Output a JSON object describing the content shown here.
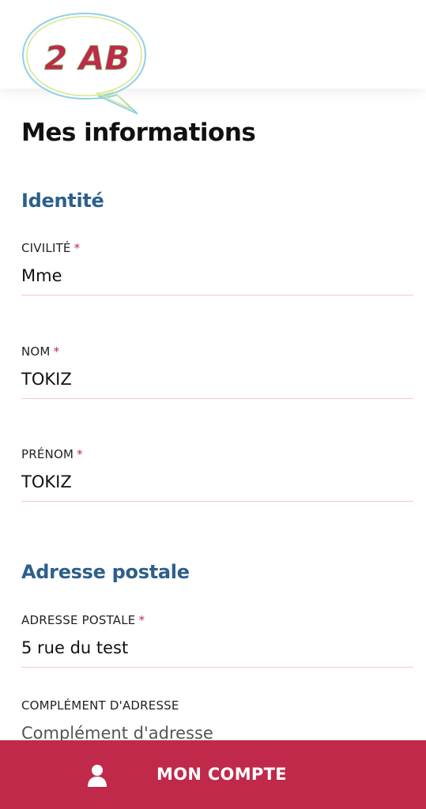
{
  "logo": {
    "text": "2 AB"
  },
  "header": {
    "menu_icon": "hamburger-menu-icon"
  },
  "page": {
    "title": "Mes informations"
  },
  "sections": {
    "identity": {
      "title": "Identité",
      "civility": {
        "label": "CIVILITÉ",
        "required": "*",
        "value": "Mme"
      },
      "last_name": {
        "label": "NOM",
        "required": "*",
        "value": "TOKIZ"
      },
      "first_name": {
        "label": "PRÉNOM",
        "required": "*",
        "value": "TOKIZ"
      }
    },
    "address": {
      "title": "Adresse postale",
      "street": {
        "label": "ADRESSE POSTALE",
        "required": "*",
        "value": "5 rue du test"
      },
      "complement": {
        "label": "COMPLÉMENT D'ADRESSE",
        "placeholder": "Complément d'adresse"
      }
    }
  },
  "bottom_bar": {
    "label": "MON COMPTE",
    "icon": "user-icon"
  },
  "colors": {
    "accent": "#c0294a",
    "section": "#2d5f8c",
    "menu": "#3a86c8"
  }
}
